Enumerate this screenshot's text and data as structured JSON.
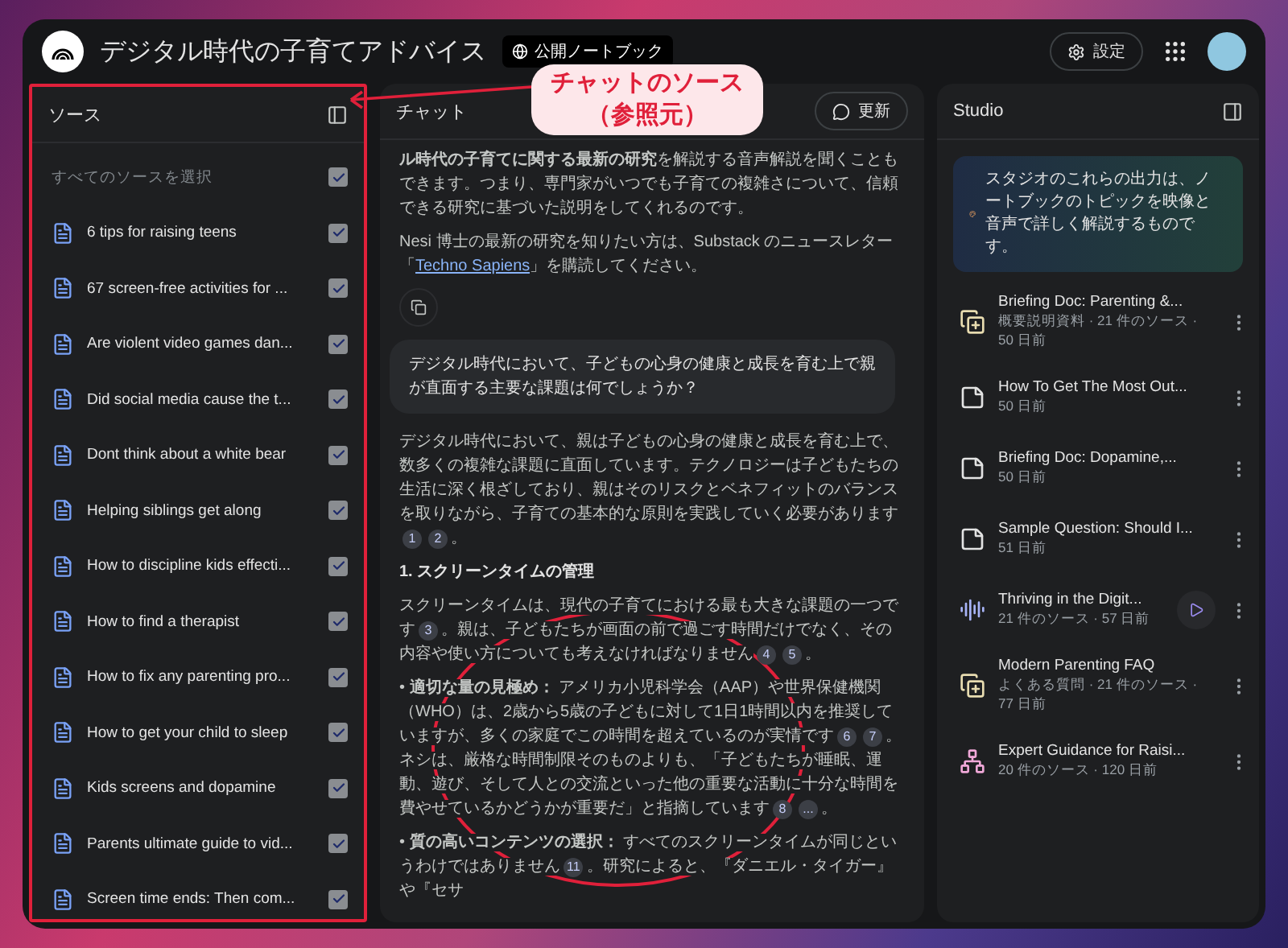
{
  "app": {
    "title": "デジタル時代の子育てアドバイス",
    "badge": "公開ノートブック",
    "settings_label": "設定"
  },
  "sources": {
    "title": "ソース",
    "select_all": {
      "label": "すべてのソースを選択",
      "checked": true
    },
    "items": [
      {
        "title": "6 tips for raising teens",
        "checked": true
      },
      {
        "title": "67 screen-free activities for ...",
        "checked": true
      },
      {
        "title": "Are violent video games dan...",
        "checked": true
      },
      {
        "title": "Did social media cause the t...",
        "checked": true
      },
      {
        "title": "Dont think about a white bear",
        "checked": true
      },
      {
        "title": "Helping siblings get along",
        "checked": true
      },
      {
        "title": "How to discipline kids effecti...",
        "checked": true
      },
      {
        "title": "How to find a therapist",
        "checked": true
      },
      {
        "title": "How to fix any parenting pro...",
        "checked": true
      },
      {
        "title": "How to get your child to sleep",
        "checked": true
      },
      {
        "title": "Kids screens and dopamine",
        "checked": true
      },
      {
        "title": "Parents ultimate guide to vid...",
        "checked": true
      },
      {
        "title": "Screen time ends: Then com...",
        "checked": true
      }
    ]
  },
  "chat": {
    "title": "チャット",
    "refresh_label": "更新",
    "intro": [
      {
        "parts": [
          {
            "kind": "text",
            "text": "**ル時代の子育てに関する最新の研究**を解説する音声解説を聞くこともできます。つまり、専門家がいつでも子育ての複雑さについて、信頼できる研究に基づいた説明をしてくれるのです。"
          }
        ]
      },
      {
        "parts": [
          {
            "kind": "text",
            "text": "Nesi 博士の最新の研究を知りたい方は、Substack のニュースレター「"
          },
          {
            "kind": "link",
            "text": "Techno Sapiens"
          },
          {
            "kind": "text",
            "text": "」を購読してください。"
          }
        ]
      }
    ],
    "question": "デジタル時代において、子どもの心身の健康と成長を育む上で親が直面する主要な課題は何でしょうか？",
    "answer": [
      {
        "kind": "paragraph",
        "parts": [
          {
            "kind": "text",
            "text": "デジタル時代において、親は子どもの心身の健康と成長を育む上で、数多くの複雑な課題に直面しています。テクノロジーは子どもたちの生活に深く根ざしており、親はそのリスクとベネフィットのバランスを取りながら、子育ての基本的な原則を実践していく必要があります"
          },
          {
            "kind": "cite",
            "text": "1"
          },
          {
            "kind": "cite",
            "text": "2"
          },
          {
            "kind": "text",
            "text": "。"
          }
        ]
      },
      {
        "kind": "heading",
        "parts": [
          {
            "kind": "text",
            "text": "1. スクリーンタイムの管理"
          }
        ]
      },
      {
        "kind": "paragraph",
        "parts": [
          {
            "kind": "text",
            "text": "スクリーンタイムは、現代の子育てにおける最も大きな課題の一つです"
          },
          {
            "kind": "cite",
            "text": "3"
          },
          {
            "kind": "text",
            "text": "。親は、子どもたちが画面の前で過ごす時間だけでなく、その内容や使い方についても考えなければなりません"
          },
          {
            "kind": "cite",
            "text": "4"
          },
          {
            "kind": "cite",
            "text": "5"
          },
          {
            "kind": "text",
            "text": "。"
          }
        ]
      },
      {
        "kind": "paragraph",
        "parts": [
          {
            "kind": "text",
            "text": "• **適切な量の見極め：** アメリカ小児科学会（AAP）や世界保健機関（WHO）は、2歳から5歳の子どもに対して1日1時間以内を推奨していますが、多くの家庭でこの時間を超えているのが実情です"
          },
          {
            "kind": "cite",
            "text": "6"
          },
          {
            "kind": "cite",
            "text": "7"
          },
          {
            "kind": "text",
            "text": "。ネシは、厳格な時間制限そのものよりも、「子どもたちが睡眠、運動、遊び、そして人との交流といった他の重要な活動に十分な時間を費やせているかどうかが重要だ」と指摘しています"
          },
          {
            "kind": "cite",
            "text": "8"
          },
          {
            "kind": "cite",
            "text": "..."
          },
          {
            "kind": "text",
            "text": "。"
          }
        ]
      },
      {
        "kind": "paragraph",
        "parts": [
          {
            "kind": "text",
            "text": "• **質の高いコンテンツの選択：** すべてのスクリーンタイムが同じというわけではありません"
          },
          {
            "kind": "cite",
            "text": "11"
          },
          {
            "kind": "text",
            "text": "。研究によると、『ダニエル・タイガー』や『セサ"
          }
        ]
      }
    ]
  },
  "studio": {
    "title": "Studio",
    "banner": "スタジオのこれらの出力は、ノートブックのトピックを映像と音声で詳しく解説するものです。",
    "items": [
      {
        "kind": "briefing",
        "title": "Briefing Doc: Parenting &...",
        "meta": "概要説明資料 · 21 件のソース · 50 日前"
      },
      {
        "kind": "note",
        "title": "How To Get The Most Out...",
        "meta": "50 日前"
      },
      {
        "kind": "note",
        "title": "Briefing Doc: Dopamine,...",
        "meta": "50 日前"
      },
      {
        "kind": "note",
        "title": "Sample Question: Should I...",
        "meta": "51 日前"
      },
      {
        "kind": "audio",
        "title": "Thriving in the Digit...",
        "meta": "21 件のソース · 57 日前"
      },
      {
        "kind": "briefing",
        "title": "Modern Parenting FAQ",
        "meta": "よくある質問 · 21 件のソース · 77 日前"
      },
      {
        "kind": "mindmap",
        "title": "Expert Guidance for Raisi...",
        "meta": "20 件のソース · 120 日前"
      }
    ]
  },
  "annotation": {
    "lines": [
      "チャットのソース",
      "（参照元）"
    ]
  }
}
